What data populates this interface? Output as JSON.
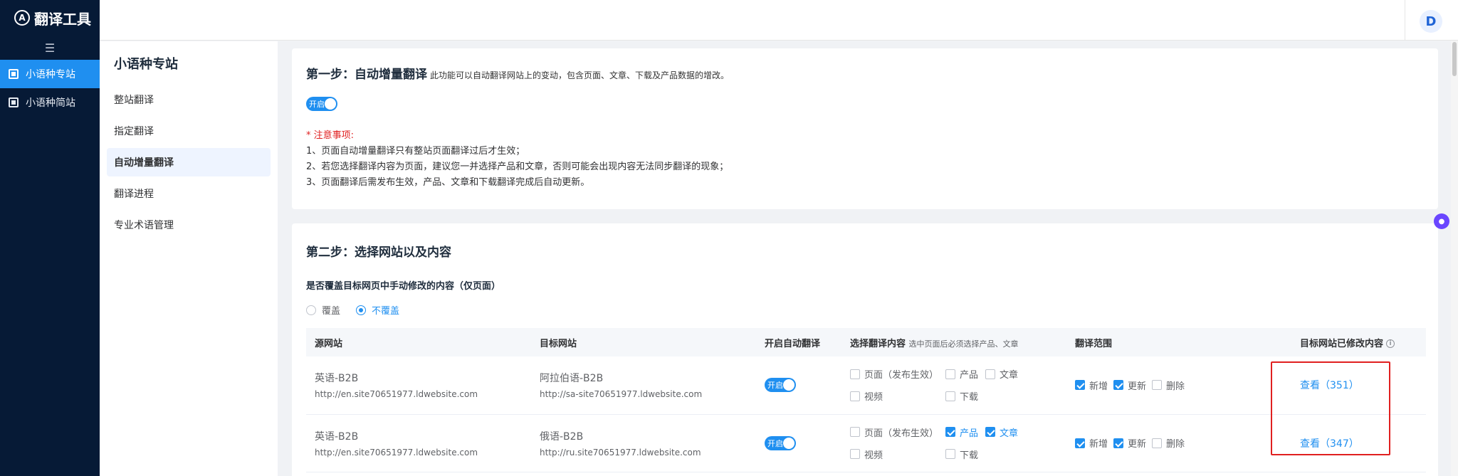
{
  "brand": {
    "logo_letter": "A",
    "title": "翻译工具",
    "collapse_icon": "menu-collapse-icon"
  },
  "sidebar": {
    "items": [
      {
        "label": "小语种专站",
        "active": true
      },
      {
        "label": "小语种简站",
        "active": false
      }
    ]
  },
  "topbar": {
    "avatar_letter": "D"
  },
  "subnav": {
    "title": "小语种专站",
    "items": [
      {
        "label": "整站翻译"
      },
      {
        "label": "指定翻译"
      },
      {
        "label": "自动增量翻译",
        "active": true
      },
      {
        "label": "翻译进程"
      },
      {
        "label": "专业术语管理"
      }
    ]
  },
  "step1": {
    "title": "第一步：自动增量翻译",
    "desc": "此功能可以自动翻译网站上的变动，包含页面、文章、下载及产品数据的增改。",
    "toggle_label": "开启",
    "notes_title": "* 注意事项:",
    "notes": [
      "1、页面自动增量翻译只有整站页面翻译过后才生效；",
      "2、若您选择翻译内容为页面，建议您一并选择产品和文章，否则可能会出现内容无法同步翻译的现象；",
      "3、页面翻译后需发布生效，产品、文章和下载翻译完成后自动更新。"
    ]
  },
  "step2": {
    "title": "第二步：选择网站以及内容",
    "override_label": "是否覆盖目标网页中手动修改的内容（仅页面）",
    "radio_override": "覆盖",
    "radio_no_override": "不覆盖",
    "selected": "不覆盖"
  },
  "table": {
    "headers": {
      "source": "源网站",
      "target": "目标网站",
      "auto": "开启自动翻译",
      "content": "选择翻译内容",
      "content_hint": "选中页面后必须选择产品、文章",
      "range": "翻译范围",
      "modified": "目标网站已修改内容"
    },
    "rows": [
      {
        "source_name": "英语-B2B",
        "source_url": "http://en.site70651977.ldwebsite.com",
        "target_name": "阿拉伯语-B2B",
        "target_url": "http://sa-site70651977.ldwebsite.com",
        "toggle": "开启",
        "content": {
          "page": "页面（发布生效）",
          "product": "产品",
          "article": "文章",
          "video": "视频",
          "download": "下载"
        },
        "range": {
          "add": "新增",
          "update": "更新",
          "delete": "删除"
        },
        "view": "查看（351）"
      },
      {
        "source_name": "英语-B2B",
        "source_url": "http://en.site70651977.ldwebsite.com",
        "target_name": "俄语-B2B",
        "target_url": "http://ru.site70651977.ldwebsite.com",
        "toggle": "开启",
        "content": {
          "page": "页面（发布生效）",
          "product": "产品",
          "article": "文章",
          "video": "视频",
          "download": "下载"
        },
        "range": {
          "add": "新增",
          "update": "更新",
          "delete": "删除"
        },
        "view": "查看（347）"
      }
    ]
  },
  "colors": {
    "sidebar_bg": "#061a36",
    "accent": "#1f8ff0",
    "warning": "#e02020"
  }
}
